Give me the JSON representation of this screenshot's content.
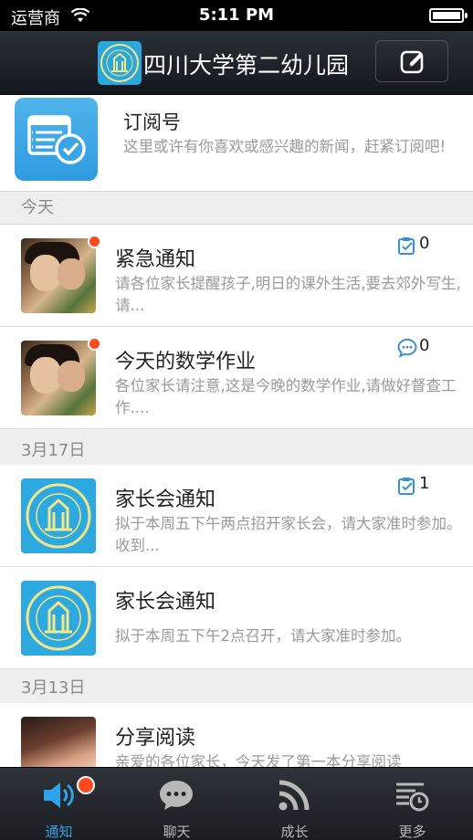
{
  "status_bar": {
    "carrier": "运营商",
    "time": "5:11 PM"
  },
  "nav": {
    "title": "四川大学第二幼儿园"
  },
  "subscription": {
    "title": "订阅号",
    "description": "这里或许有你喜欢或感兴趣的新闻，赶紧订阅吧!"
  },
  "sections": [
    {
      "header": "今天",
      "messages": [
        {
          "title": "紧急通知",
          "body": "请各位家长提醒孩子,明日的课外生活,要去郊外写生,请...",
          "count": "0",
          "counter_icon": "checklist-icon"
        },
        {
          "title": "今天的数学作业",
          "body": "各位家长请注意,这是今晚的数学作业,请做好督查工作....",
          "count": "0",
          "counter_icon": "chat-bubble-icon"
        }
      ]
    },
    {
      "header": "3月17日",
      "messages": [
        {
          "title": "家长会通知",
          "body": "拟于本周五下午两点招开家长会，请大家准时参加。收到...",
          "count": "1",
          "counter_icon": "checklist-icon"
        },
        {
          "title": "家长会通知",
          "body": "拟于本周五下午2点召开，请大家准时参加。"
        }
      ]
    },
    {
      "header": "3月13日",
      "messages": [
        {
          "title": "分享阅读",
          "body": "亲爱的各位家长，今天发了第一本分享阅读"
        }
      ]
    }
  ],
  "tabs": [
    {
      "label": "通知",
      "icon": "speaker-icon",
      "active": true
    },
    {
      "label": "聊天",
      "icon": "chat-icon"
    },
    {
      "label": "成长",
      "icon": "rss-icon"
    },
    {
      "label": "更多",
      "icon": "more-icon"
    }
  ],
  "colors": {
    "accent": "#2fa3ea",
    "badge": "#ff4a1c",
    "nav_bg": "#1c2026"
  }
}
